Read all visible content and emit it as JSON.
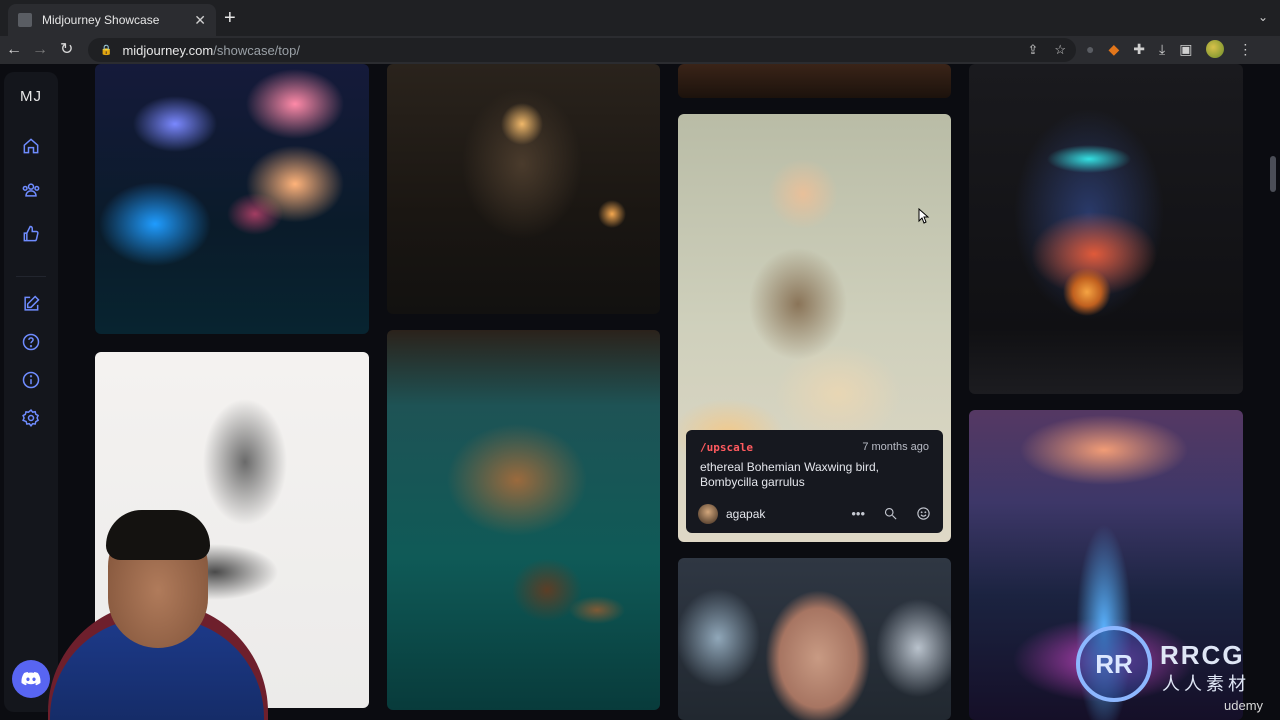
{
  "browser": {
    "tab_title": "Midjourney Showcase",
    "url_host": "midjourney.com",
    "url_path": "/showcase/top/"
  },
  "sidebar": {
    "logo": "MJ"
  },
  "info_card": {
    "command": "/upscale",
    "time": "7 months ago",
    "prompt": "ethereal Bohemian Waxwing bird, Bombycilla garrulus",
    "username": "agapak"
  },
  "watermark": {
    "logo": "RR",
    "text": "RRCG",
    "sub": "人人素材",
    "udemy": "udemy"
  },
  "colors": {
    "accent": "#6f8cff",
    "discord": "#5865f2",
    "command": "#ff5a5f"
  }
}
